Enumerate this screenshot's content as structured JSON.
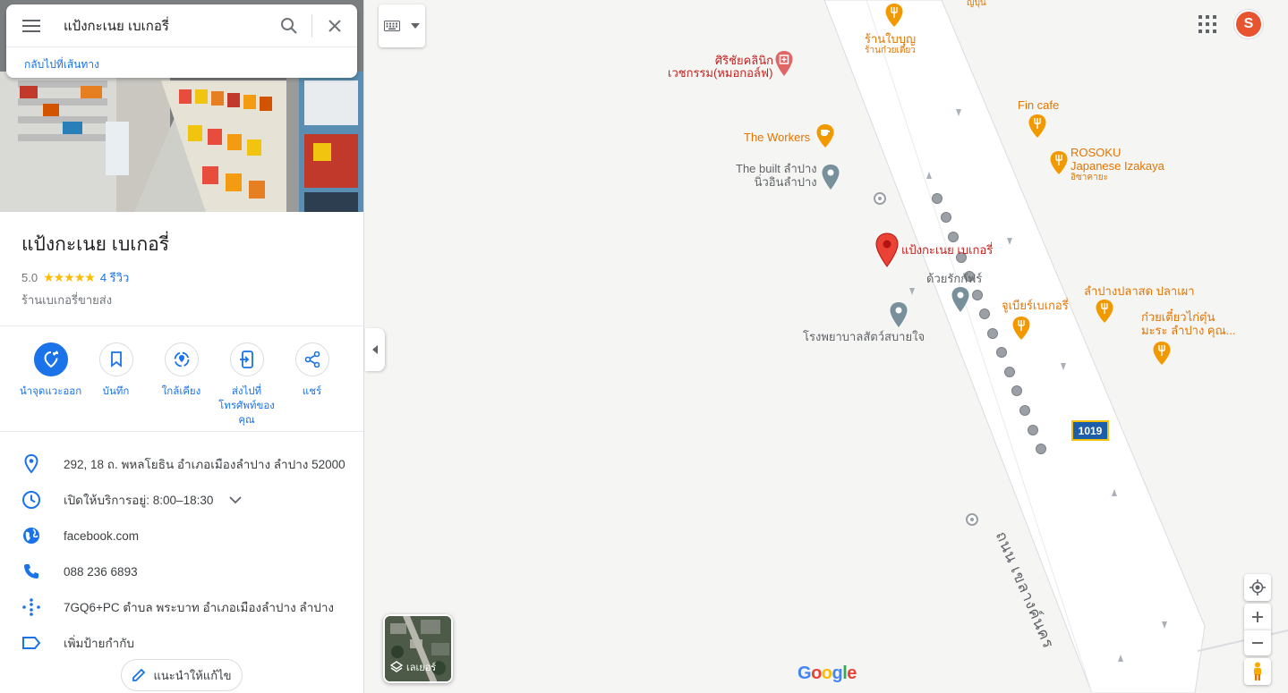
{
  "search": {
    "query": "แป้งกะเนย เบเกอรี่",
    "back_link": "กลับไปที่เส้นทาง"
  },
  "place": {
    "title": "แป้งกะเนย เบเกอรี่",
    "rating": "5.0",
    "stars": "★★★★★",
    "reviews": "4 รีวิว",
    "category": "ร้านเบเกอรี่ขายส่ง"
  },
  "actions": [
    {
      "label": "นำจุดแวะออก",
      "icon": "remove-stop-icon"
    },
    {
      "label": "บันทึก",
      "icon": "bookmark-icon"
    },
    {
      "label": "ใกล้เคียง",
      "icon": "nearby-icon"
    },
    {
      "label": "ส่งไปที่โทรศัพท์ของคุณ",
      "icon": "send-to-phone-icon"
    },
    {
      "label": "แชร์",
      "icon": "share-icon"
    }
  ],
  "details": {
    "address": "292, 18 ถ. พหลโยธิน อำเภอเมืองลำปาง ลำปาง 52000",
    "hours": "เปิดให้บริการอยู่:  8:00–18:30",
    "website": "facebook.com",
    "phone": "088 236 6893",
    "plus_code": "7GQ6+PC ตำบล พระบาท อำเภอเมืองลำปาง ลำปาง",
    "add_label": "เพิ่มป้ายกำกับ"
  },
  "suggest_edit": "แนะนำให้แก้ไข",
  "map": {
    "pois": {
      "top_cut": "ญี่ปุ่น",
      "ranbaibun": "ร้านใบบุญ",
      "ranbaibun_sub": "ร้านก๋วยเตี๋ยว",
      "clinic_1": "ศิริชัยคลินิก",
      "clinic_2": "เวชกรรม(หมอกอล์ฟ)",
      "fin_cafe": "Fin cafe",
      "the_workers": "The Workers",
      "rosoku_1": "ROSOKU",
      "rosoku_2": "Japanese Izakaya",
      "rosoku_sub": "อิซาคายะ",
      "the_built_1": "The built ลำปาง",
      "the_built_2": "นิ่วอินลำปาง",
      "selected": "แป้งกะเนย เบเกอรี่",
      "duayrak": "ด้วยรักกัฟร์",
      "lampang_plaza": "ลำปางปลาสด ปลาเผา",
      "jubiar": "จูเบียร์เบเกอรี่",
      "kuaytiew_1": "ก๋วยเตี๋ยวไก่ตุ๋น",
      "kuaytiew_2": "มะระ ลำปาง คุณ...",
      "vet": "โรงพยาบาลสัตว์สบายใจ"
    },
    "road_number": "1019",
    "road_name": "ถนน เขลางค์นคร",
    "layers_label": "เลเยอร์",
    "account_initial": "S",
    "logo": {
      "G": "G",
      "o1": "o",
      "o2": "o",
      "g": "g",
      "l": "l",
      "e": "e"
    },
    "colors": {
      "accent": "#1a73e8",
      "pin_red": "#ea4335",
      "food_orange": "#f29900",
      "road_shield": "#1c5ea8"
    }
  }
}
